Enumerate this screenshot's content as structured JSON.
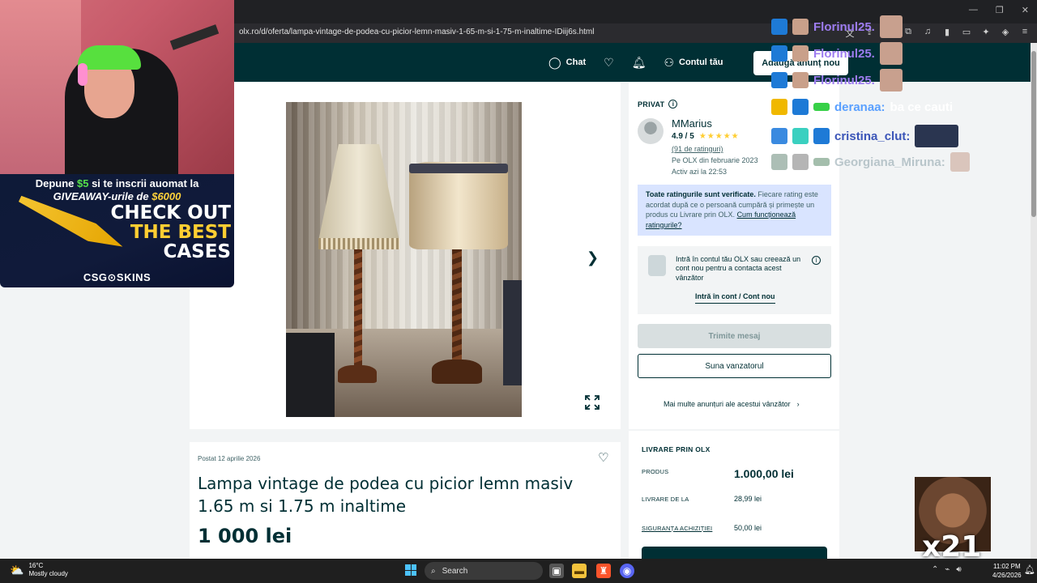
{
  "browser": {
    "url": "olx.ro/d/oferta/lampa-vintage-de-podea-cu-picior-lemn-masiv-1-65-m-si-1-75-m-inaltime-IDiij6s.html"
  },
  "header": {
    "chat_label": "Chat",
    "account_label": "Contul tău",
    "post_ad_label": "Adaugă anunț nou"
  },
  "seller": {
    "type_label": "PRIVAT",
    "name": "MMarius",
    "rating": "4.9 / 5",
    "stars": "★★★★★",
    "ratings_count": "(91 de ratinguri)",
    "member_since": "Pe OLX din februarie 2023",
    "last_active": "Activ azi la 22:53",
    "verified_title": "Toate ratingurile sunt verificate.",
    "verified_text": " Fiecare rating este acordat după ce o persoană cumpără și primește un produs cu Livrare prin OLX. ",
    "verified_link": "Cum funcționează ratingurile?",
    "login_prompt": "Intră în contul tău OLX sau creează un cont nou pentru a contacta acest vânzător",
    "login_link": "Intră în cont / Cont nou",
    "send_message": "Trimite mesaj",
    "call_seller": "Suna vanzatorul",
    "more_ads": "Mai multe anunțuri ale acestui vânzător"
  },
  "listing": {
    "posted": "Postat 12 aprilie 2026",
    "title": "Lampa vintage de podea cu picior lemn masiv 1.65 m si 1.75 m inaltime",
    "price": "1 000 lei"
  },
  "delivery": {
    "title": "LIVRARE PRIN OLX",
    "product_label": "PRODUS",
    "product_value": "1.000,00 lei",
    "shipping_label": "LIVRARE DE LA",
    "shipping_value": "28,99 lei",
    "safety_label": "SIGURANȚA ACHIZIȚIEI",
    "safety_value": "50,00 lei"
  },
  "stream": {
    "promo_line1_a": "Depune ",
    "promo_line1_b": "$5",
    "promo_line1_c": " si te inscrii auomat la",
    "promo_line2_a": "GIVEAWAY-urile de ",
    "promo_line2_b": "$6000",
    "promo_headline_1": "CHECK OUT",
    "promo_headline_2": "THE BEST",
    "promo_headline_3": "CASES",
    "promo_brand": "CSG⊙SKINS",
    "chat": [
      {
        "user": "Florinul25.",
        "msg": ""
      },
      {
        "user": "Florinul25.",
        "msg": ""
      },
      {
        "user": "Florinul25.",
        "msg": ""
      },
      {
        "user": "deranaa:",
        "msg": "ba ce cauti"
      },
      {
        "user": "cristina_clut:",
        "msg": ""
      },
      {
        "user": "Georgiana_Miruna:",
        "msg": ""
      }
    ],
    "meme_counter": "x21"
  },
  "taskbar": {
    "temp": "16°C",
    "weather": "Mostly cloudy",
    "search_placeholder": "Search",
    "time": "11:02 PM",
    "date": "4/26/2026"
  },
  "colors": {
    "olx_dark": "#002f34",
    "star": "#ffce32",
    "verified_bg": "#d9e4ff",
    "chat_user": "#9d7cf0"
  }
}
